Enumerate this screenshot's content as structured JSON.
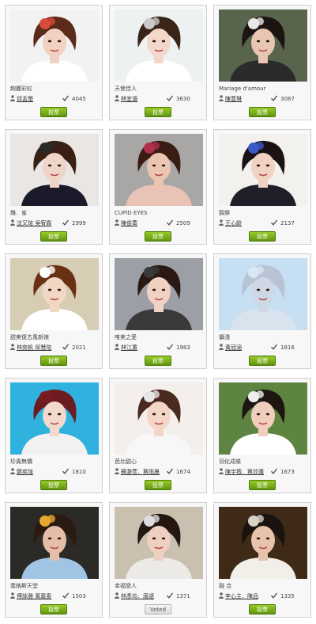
{
  "vote_label": "投票",
  "cards": [
    {
      "title": "絢麗彩虹",
      "author": "邱孟螢",
      "votes": "4045",
      "button": "投票",
      "voted": false,
      "photo": {
        "bg": "#f2f2f2",
        "hair": "#5a2a1a",
        "skin": "#f1d2c2",
        "accent": "#d94a3a",
        "dress": "#ffffff"
      }
    },
    {
      "title": "天使佳人",
      "author": "林宜湄",
      "votes": "3630",
      "button": "投票",
      "voted": false,
      "photo": {
        "bg": "#eef1f2",
        "hair": "#3a2418",
        "skin": "#f3d8ca",
        "accent": "#c9c9c9",
        "dress": "#ffffff"
      }
    },
    {
      "title": "Mariage d'amour",
      "author": "陳薏琳",
      "votes": "3087",
      "button": "投票",
      "voted": false,
      "photo": {
        "bg": "#58644c",
        "hair": "#1c1410",
        "skin": "#e9c6b3",
        "accent": "#e8e8e8",
        "dress": "#2b2b2b"
      }
    },
    {
      "title": "雛．雀",
      "author": "沈又瑄 吳宥霖",
      "votes": "2999",
      "button": "投票",
      "voted": false,
      "photo": {
        "bg": "#e9e6e4",
        "hair": "#3a1f14",
        "skin": "#efd5c8",
        "accent": "#2a2a2a",
        "dress": "#1a1a2a"
      }
    },
    {
      "title": "CUPID EYES",
      "author": "陳俊菁",
      "votes": "2509",
      "button": "投票",
      "voted": false,
      "photo": {
        "bg": "#a9a7a6",
        "hair": "#3a1c12",
        "skin": "#ecc4b2",
        "accent": "#b1304a",
        "dress": "#e9c3b6"
      }
    },
    {
      "title": "靚樂",
      "author": "王心齡",
      "votes": "2137",
      "button": "投票",
      "voted": false,
      "photo": {
        "bg": "#f3f1ee",
        "hair": "#1c1212",
        "skin": "#f0d1c2",
        "accent": "#3a58c8",
        "dress": "#1f1f2a"
      }
    },
    {
      "title": "甜美復古風新娘",
      "author": "林奕帆 邱慧瑄",
      "votes": "2021",
      "button": "投票",
      "voted": false,
      "photo": {
        "bg": "#d7cdb4",
        "hair": "#6a3014",
        "skin": "#f3d7c5",
        "accent": "#ffffff",
        "dress": "#ffffff"
      }
    },
    {
      "title": "唯美之愛",
      "author": "林江蕙",
      "votes": "1983",
      "button": "投票",
      "voted": false,
      "photo": {
        "bg": "#9c9fa6",
        "hair": "#2a1812",
        "skin": "#f1d2c2",
        "accent": "#3a3a3a",
        "dress": "#3a3a3a"
      }
    },
    {
      "title": "攝淺",
      "author": "黃冠涵",
      "votes": "1816",
      "button": "投票",
      "voted": false,
      "photo": {
        "bg": "#c6dff2",
        "hair": "#b8c4d6",
        "skin": "#cfd8e4",
        "accent": "#d9e8f5",
        "dress": "#d9e3ee"
      }
    },
    {
      "title": "珍貴無價",
      "author": "鄭奕瑄",
      "votes": "1810",
      "button": "投票",
      "voted": false,
      "photo": {
        "bg": "#2fb2dd",
        "hair": "#6b1c20",
        "skin": "#f3d8cd",
        "accent": "#7a1a22",
        "dress": "#f2f2f2"
      }
    },
    {
      "title": "芭比甜心",
      "author": "蘇瀞萱．蔡雨晨",
      "votes": "1674",
      "button": "投票",
      "voted": false,
      "photo": {
        "bg": "#f4efec",
        "hair": "#4a2a1e",
        "skin": "#f3d6c7",
        "accent": "#e6e6e6",
        "dress": "#f7f7f7"
      }
    },
    {
      "title": "羽化成蝶",
      "author": "陳宇薇．蔡欣蓮",
      "votes": "1673",
      "button": "投票",
      "voted": false,
      "photo": {
        "bg": "#5d8440",
        "hair": "#1e1612",
        "skin": "#f0cdbd",
        "accent": "#efefef",
        "dress": "#ffffff"
      }
    },
    {
      "title": "喬納斯天堂",
      "author": "傅詠雅 黃嘉雯",
      "votes": "1503",
      "button": "投票",
      "voted": false,
      "photo": {
        "bg": "#2c2a26",
        "hair": "#2a1a12",
        "skin": "#e6bda8",
        "accent": "#e8a830",
        "dress": "#a0c4e4"
      }
    },
    {
      "title": "幸福戀人",
      "author": "林彥均．唐語",
      "votes": "1371",
      "button": "Voted",
      "voted": true,
      "photo": {
        "bg": "#c9c0b0",
        "hair": "#241712",
        "skin": "#efcfc0",
        "accent": "#dcdcdc",
        "dress": "#eceae6"
      }
    },
    {
      "title": "融 合",
      "author": "李心主．陳品",
      "votes": "1335",
      "button": "投票",
      "voted": false,
      "photo": {
        "bg": "#3f2a18",
        "hair": "#1a120e",
        "skin": "#e7c2ad",
        "accent": "#d9d0c6",
        "dress": "#f2efe8"
      }
    }
  ]
}
